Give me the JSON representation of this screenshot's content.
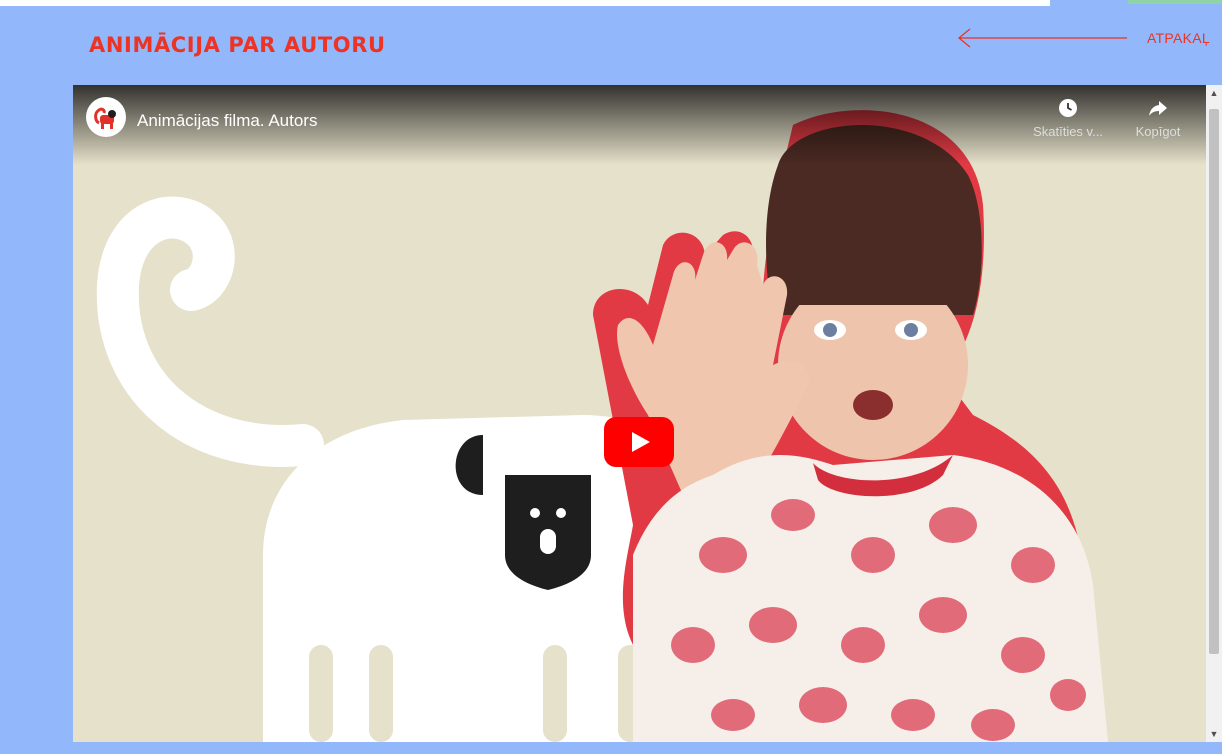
{
  "page": {
    "title": "ANIMĀCIJA PAR AUTORU",
    "back_label": "ATPAKAĻ",
    "back_icon": "arrow-left-icon"
  },
  "video": {
    "title": "Animācijas filma. Autors",
    "channel_icon": "monkey-logo-icon",
    "watch_later_label": "Skatīties v...",
    "watch_later_icon": "clock-icon",
    "share_label": "Kopīgot",
    "share_icon": "share-arrow-icon",
    "play_icon": "youtube-play-icon"
  },
  "colors": {
    "page_background": "#92b8fb",
    "accent": "#ec3324",
    "youtube_red": "#ff0000",
    "video_background": "#e5e0c9"
  }
}
